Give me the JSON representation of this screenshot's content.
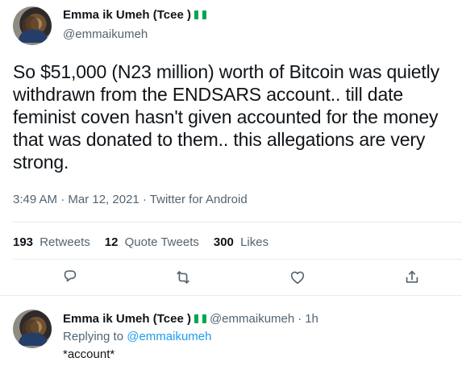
{
  "tweet": {
    "author_name": "Emma ik Umeh (Tcee )",
    "author_handle": "@emmaikumeh",
    "text": "So $51,000 (N23 million) worth of Bitcoin was quietly withdrawn from the ENDSARS account.. till date feminist coven hasn't given accounted for the money that was donated to them.. this allegations are very strong.",
    "meta": "3:49 AM · Mar 12, 2021 · Twitter for Android",
    "retweets_count": "193",
    "retweets_label": "Retweets",
    "quote_tweets_count": "12",
    "quote_tweets_label": "Quote Tweets",
    "likes_count": "300",
    "likes_label": "Likes",
    "icons": {
      "reply": "reply-icon",
      "retweet": "retweet-icon",
      "like": "heart-icon",
      "share": "share-icon"
    }
  },
  "reply": {
    "author_name": "Emma ik Umeh (Tcee )",
    "author_handle": "@emmaikumeh",
    "separator": "·",
    "time": "1h",
    "replying_prefix": "Replying to",
    "replying_to": "@emmaikumeh",
    "text": "*account*"
  },
  "colors": {
    "text": "#0f1419",
    "muted": "#536471",
    "link": "#1d9bf0",
    "flag_green": "#00a650",
    "divider": "#e6ecf0"
  }
}
